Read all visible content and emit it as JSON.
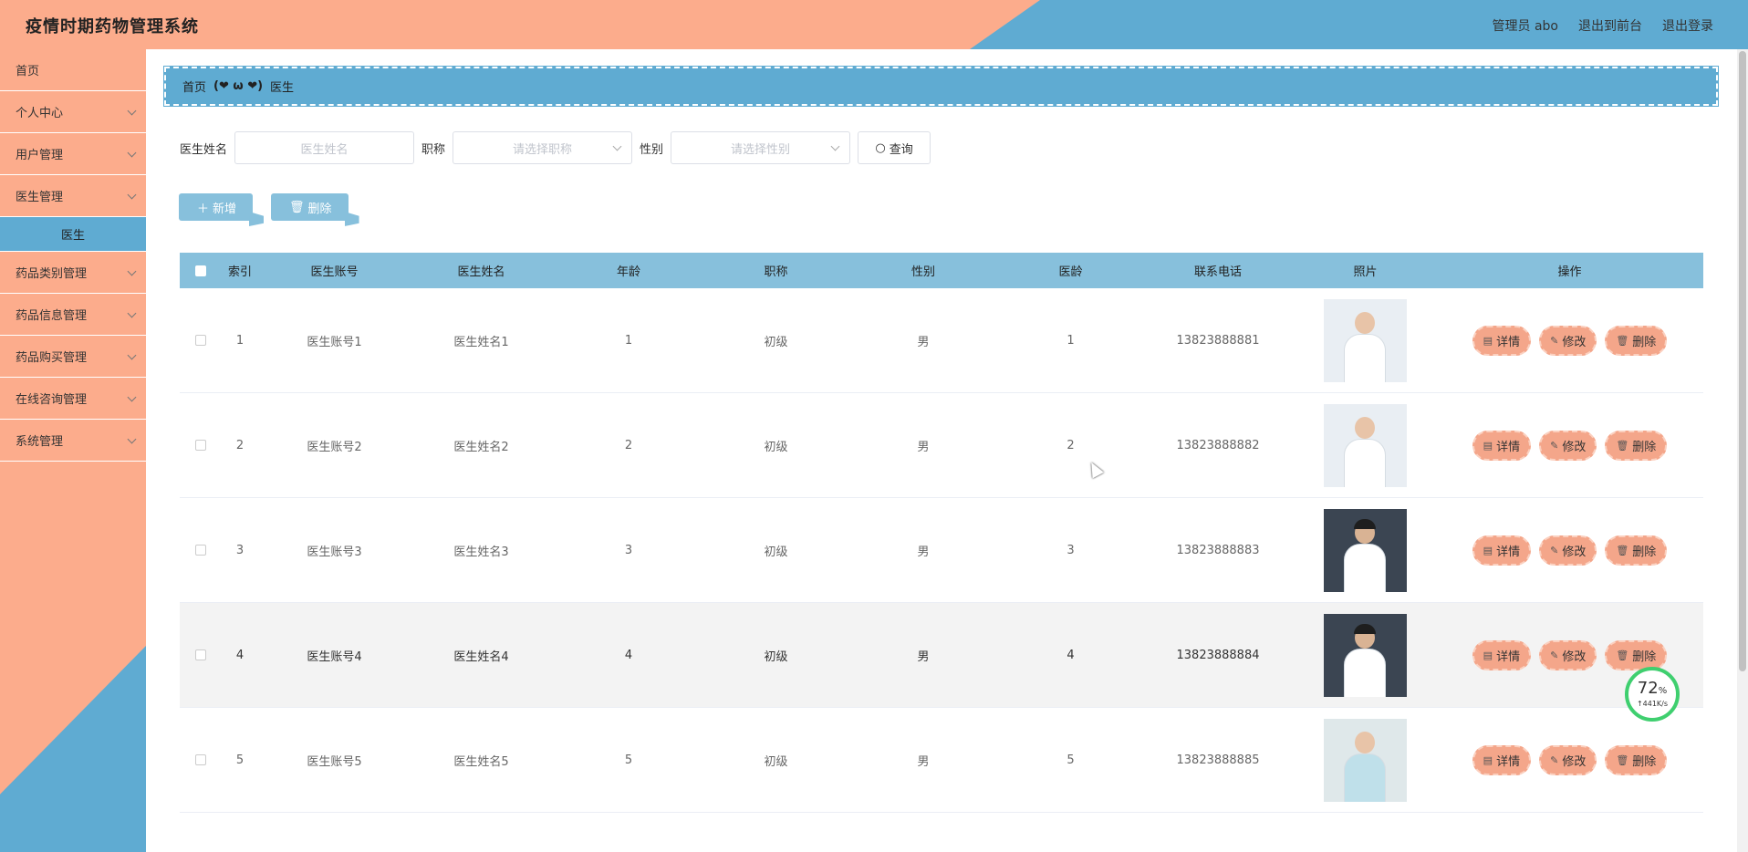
{
  "header": {
    "title": "疫情时期药物管理系统",
    "admin": "管理员 abo",
    "to_front": "退出到前台",
    "logout": "退出登录"
  },
  "sidebar": {
    "items": [
      {
        "label": "首页",
        "has_children": false
      },
      {
        "label": "个人中心",
        "has_children": true
      },
      {
        "label": "用户管理",
        "has_children": true
      },
      {
        "label": "医生管理",
        "has_children": true
      },
      {
        "label": "医生",
        "sub": true
      },
      {
        "label": "药品类别管理",
        "has_children": true
      },
      {
        "label": "药品信息管理",
        "has_children": true
      },
      {
        "label": "药品购买管理",
        "has_children": true
      },
      {
        "label": "在线咨询管理",
        "has_children": true
      },
      {
        "label": "系统管理",
        "has_children": true
      }
    ]
  },
  "breadcrumb": {
    "home": "首页",
    "sep": "(❤ ω ❤)",
    "current": "医生"
  },
  "search": {
    "name_label": "医生姓名",
    "name_placeholder": "医生姓名",
    "title_label": "职称",
    "title_placeholder": "请选择职称",
    "sex_label": "性别",
    "sex_placeholder": "请选择性别",
    "query": "查询"
  },
  "actions": {
    "add": "新增",
    "delete": "删除"
  },
  "table": {
    "headers": [
      "索引",
      "医生账号",
      "医生姓名",
      "年龄",
      "职称",
      "性别",
      "医龄",
      "联系电话",
      "照片",
      "操作"
    ],
    "rows": [
      {
        "idx": "1",
        "account": "医生账号1",
        "name": "医生姓名1",
        "age": "1",
        "title": "初级",
        "sex": "男",
        "years": "1",
        "phone": "13823888881"
      },
      {
        "idx": "2",
        "account": "医生账号2",
        "name": "医生姓名2",
        "age": "2",
        "title": "初级",
        "sex": "男",
        "years": "2",
        "phone": "13823888882"
      },
      {
        "idx": "3",
        "account": "医生账号3",
        "name": "医生姓名3",
        "age": "3",
        "title": "初级",
        "sex": "男",
        "years": "3",
        "phone": "13823888883"
      },
      {
        "idx": "4",
        "account": "医生账号4",
        "name": "医生姓名4",
        "age": "4",
        "title": "初级",
        "sex": "男",
        "years": "4",
        "phone": "13823888884"
      },
      {
        "idx": "5",
        "account": "医生账号5",
        "name": "医生姓名5",
        "age": "5",
        "title": "初级",
        "sex": "男",
        "years": "5",
        "phone": "13823888885"
      }
    ],
    "ops": {
      "detail": "详情",
      "edit": "修改",
      "del": "删除"
    }
  },
  "net_widget": {
    "percent": "72",
    "unit": "%",
    "speed": "↑441K/s"
  },
  "colors": {
    "salmon": "#fcac8c",
    "blue": "#5fabd2",
    "light_blue": "#87c0dc",
    "op_button": "#f4a68a"
  }
}
